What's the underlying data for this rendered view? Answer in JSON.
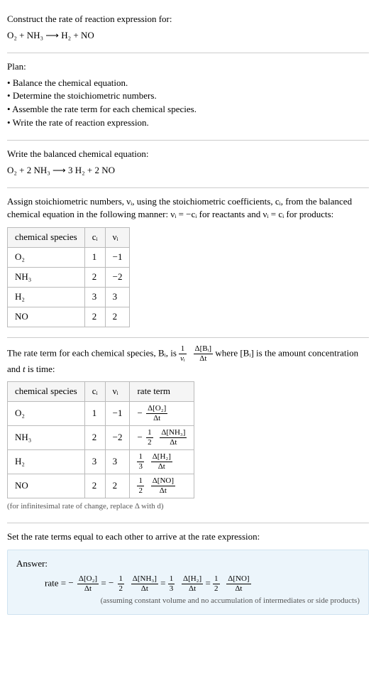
{
  "header": {
    "prompt": "Construct the rate of reaction expression for:",
    "equation_unbalanced": "O₂ + NH₃  ⟶  H₂ + NO"
  },
  "plan": {
    "title": "Plan:",
    "items": [
      "Balance the chemical equation.",
      "Determine the stoichiometric numbers.",
      "Assemble the rate term for each chemical species.",
      "Write the rate of reaction expression."
    ]
  },
  "balanced": {
    "title": "Write the balanced chemical equation:",
    "equation": "O₂ + 2 NH₃  ⟶  3 H₂ + 2 NO"
  },
  "stoich": {
    "intro": "Assign stoichiometric numbers, νᵢ, using the stoichiometric coefficients, cᵢ, from the balanced chemical equation in the following manner: νᵢ = −cᵢ for reactants and νᵢ = cᵢ for products:",
    "headers": {
      "species": "chemical species",
      "ci": "cᵢ",
      "vi": "νᵢ"
    },
    "rows": [
      {
        "species": "O₂",
        "ci": "1",
        "vi": "−1"
      },
      {
        "species": "NH₃",
        "ci": "2",
        "vi": "−2"
      },
      {
        "species": "H₂",
        "ci": "3",
        "vi": "3"
      },
      {
        "species": "NO",
        "ci": "2",
        "vi": "2"
      }
    ]
  },
  "rateterm": {
    "intro_a": "The rate term for each chemical species, Bᵢ, is ",
    "intro_b": " where [Bᵢ] is the amount concentration and ",
    "intro_c": " is time:",
    "t_label": "t",
    "frac1": {
      "num": "1",
      "den": "νᵢ"
    },
    "frac2": {
      "num": "Δ[Bᵢ]",
      "den": "Δt"
    },
    "headers": {
      "species": "chemical species",
      "ci": "cᵢ",
      "vi": "νᵢ",
      "rate": "rate term"
    },
    "rows": [
      {
        "species": "O₂",
        "ci": "1",
        "vi": "−1",
        "pre": "−",
        "coef_num": "",
        "coef_den": "",
        "dnum": "Δ[O₂]",
        "dden": "Δt"
      },
      {
        "species": "NH₃",
        "ci": "2",
        "vi": "−2",
        "pre": "−",
        "coef_num": "1",
        "coef_den": "2",
        "dnum": "Δ[NH₃]",
        "dden": "Δt"
      },
      {
        "species": "H₂",
        "ci": "3",
        "vi": "3",
        "pre": "",
        "coef_num": "1",
        "coef_den": "3",
        "dnum": "Δ[H₂]",
        "dden": "Δt"
      },
      {
        "species": "NO",
        "ci": "2",
        "vi": "2",
        "pre": "",
        "coef_num": "1",
        "coef_den": "2",
        "dnum": "Δ[NO]",
        "dden": "Δt"
      }
    ],
    "footnote": "(for infinitesimal rate of change, replace Δ with d)"
  },
  "final": {
    "setequal": "Set the rate terms equal to each other to arrive at the rate expression:",
    "answer_label": "Answer:",
    "rate_label": "rate = ",
    "expr": {
      "t1": {
        "pre": "−",
        "coef_num": "",
        "coef_den": "",
        "dnum": "Δ[O₂]",
        "dden": "Δt"
      },
      "t2": {
        "pre": "−",
        "coef_num": "1",
        "coef_den": "2",
        "dnum": "Δ[NH₃]",
        "dden": "Δt"
      },
      "t3": {
        "pre": "",
        "coef_num": "1",
        "coef_den": "3",
        "dnum": "Δ[H₂]",
        "dden": "Δt"
      },
      "t4": {
        "pre": "",
        "coef_num": "1",
        "coef_den": "2",
        "dnum": "Δ[NO]",
        "dden": "Δt"
      }
    },
    "eq": " = ",
    "assumption": "(assuming constant volume and no accumulation of intermediates or side products)"
  }
}
